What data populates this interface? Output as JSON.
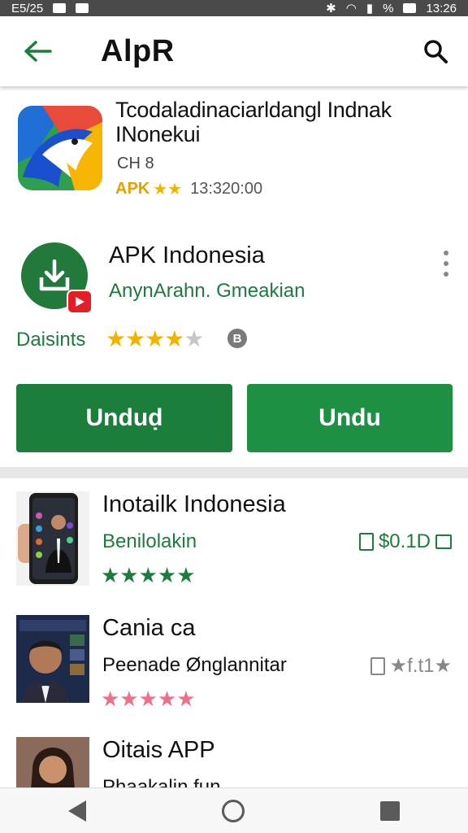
{
  "status_bar": {
    "time": "13:26",
    "left_text": "E5/25",
    "icons": [
      "image-icon",
      "mail-icon",
      "bluetooth-icon",
      "wifi-icon",
      "signal-icon",
      "battery-icon"
    ],
    "battery": "%"
  },
  "app_bar": {
    "title": "AlpR",
    "back_icon": "arrow-left-icon",
    "search_icon": "search-icon"
  },
  "featured": {
    "title": "Tcodaladinaciarldangl Indnak INonekui",
    "subtitle": "CH 8",
    "badge": "APK",
    "stars": "★★",
    "time": "13:320:00"
  },
  "detail": {
    "name": "APK Indonesia",
    "developer": "AnynArahn. Gmeakian",
    "rating_label": "Daisints",
    "rating_value": 4,
    "rating_max": 5,
    "stars_on": "★★★★",
    "stars_off": "★",
    "info": "B",
    "buttons": [
      "Unduḍ",
      "Undu"
    ]
  },
  "list": [
    {
      "title": "Inotailk Indonesia",
      "subtitle": "Benilolakin",
      "stars": "★★★★★",
      "star_color": "#1e7a3e",
      "price": "$0.1D",
      "right_color": "#1e7a3e"
    },
    {
      "title": "Cania ca",
      "subtitle": "Peenade Ønglannitar",
      "stars": "★★★★★",
      "star_color": "#ef6f8a",
      "price": "★f.t1★",
      "right_color": "#888888"
    },
    {
      "title": "Oitais APP",
      "subtitle": "Phaakalin fun",
      "stars": "",
      "star_color": "#1e7a3e",
      "price": "",
      "right_color": "#1e7a3e"
    }
  ],
  "colors": {
    "primary": "#1b7e3a",
    "secondary": "#1d9044",
    "star": "#f0b400"
  }
}
